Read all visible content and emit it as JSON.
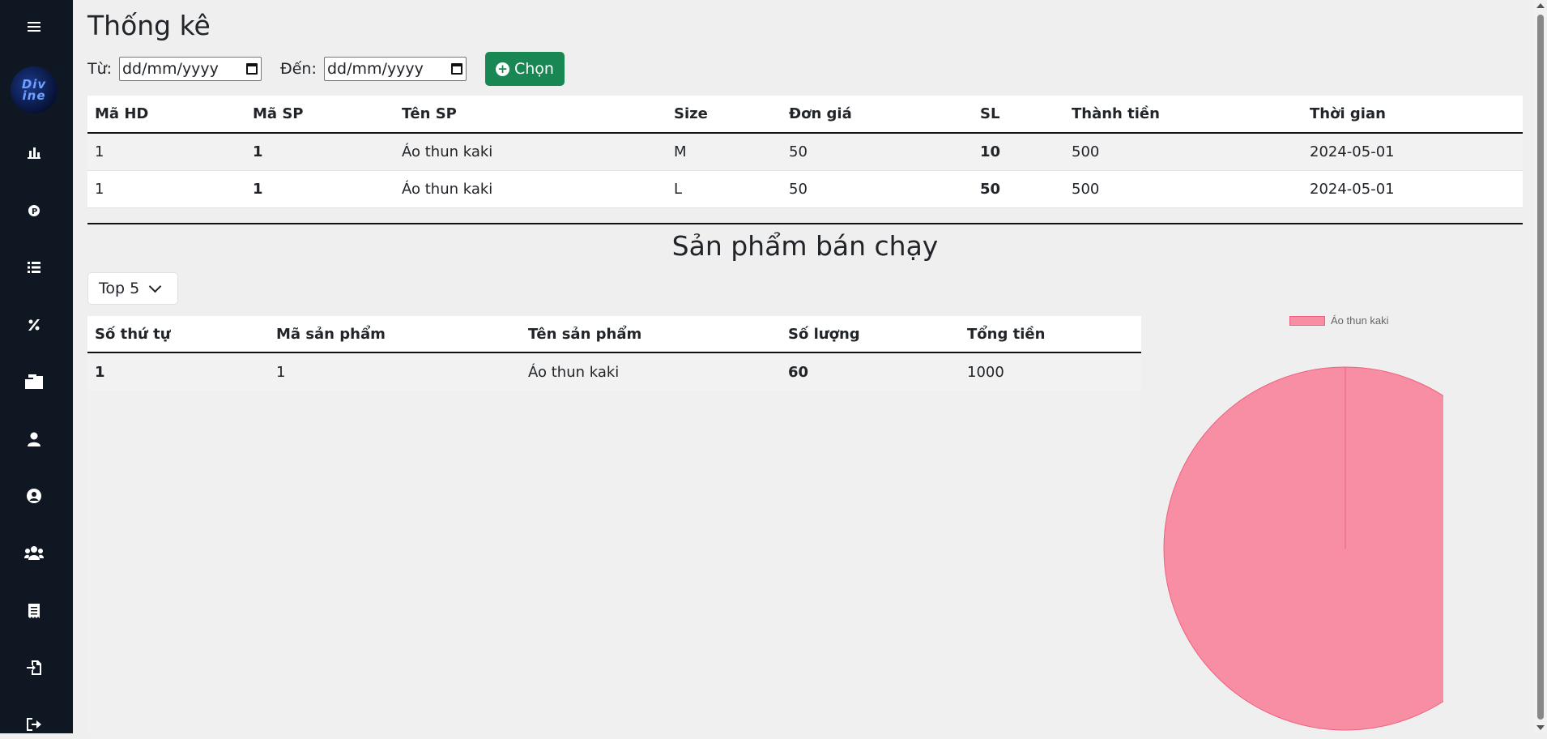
{
  "sidebar": {
    "logo_text": "Divine",
    "items": [
      {
        "icon": "menu-icon"
      },
      {
        "icon": "bar-chart-icon"
      },
      {
        "icon": "coin-icon"
      },
      {
        "icon": "list-icon"
      },
      {
        "icon": "percent-icon"
      },
      {
        "icon": "boxes-icon"
      },
      {
        "icon": "user-icon"
      },
      {
        "icon": "user-circle-icon"
      },
      {
        "icon": "users-icon"
      },
      {
        "icon": "receipt-icon"
      },
      {
        "icon": "file-import-icon"
      },
      {
        "icon": "logout-icon"
      }
    ]
  },
  "header": {
    "title": "Thống kê"
  },
  "filter": {
    "from_label": "Từ:",
    "to_label": "Đến:",
    "from_value": "dd/mm/yyyy",
    "to_value": "dd/mm/yyyy",
    "choose_label": "Chọn"
  },
  "orders": {
    "columns": [
      "Mã HD",
      "Mã SP",
      "Tên SP",
      "Size",
      "Đơn giá",
      "SL",
      "Thành tiền",
      "Thời gian"
    ],
    "rows": [
      [
        "1",
        "1",
        "Áo thun kaki",
        "M",
        "50",
        "10",
        "500",
        "2024-05-01"
      ],
      [
        "1",
        "1",
        "Áo thun kaki",
        "L",
        "50",
        "50",
        "500",
        "2024-05-01"
      ]
    ]
  },
  "best_sellers": {
    "title": "Sản phẩm bán chạy",
    "select_value": "Top 5",
    "columns": [
      "Số thứ tự",
      "Mã sản phẩm",
      "Tên sản phẩm",
      "Số lượng",
      "Tổng tiền"
    ],
    "rows": [
      [
        "1",
        "1",
        "Áo thun kaki",
        "60",
        "1000"
      ]
    ]
  },
  "chart_data": {
    "type": "pie",
    "categories": [
      "Áo thun kaki"
    ],
    "values": [
      60
    ],
    "legend": "top",
    "colors": [
      "#f88ea3"
    ]
  },
  "colors": {
    "sidebar_bg": "#0f1722",
    "accent_green": "#198754",
    "pie_fill": "#f88ea3"
  }
}
